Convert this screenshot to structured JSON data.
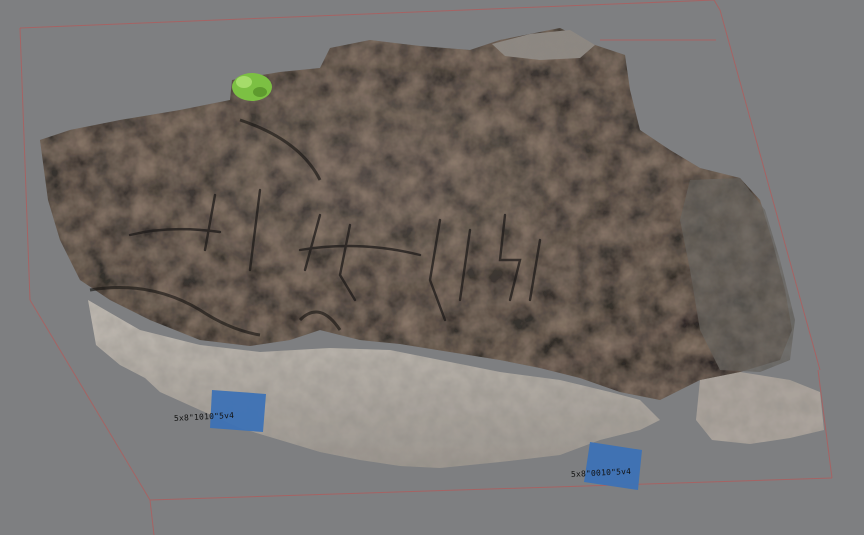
{
  "viewer": {
    "background_color": "#7e7f81",
    "bounding_box_color": "#b35a5a"
  },
  "model": {
    "dark_rock_color": "#3a3533",
    "light_rock_color": "#b2aca5",
    "highlight_color": "#8a6448"
  },
  "markers": [
    {
      "label": "5x8\"1010\"5v4",
      "color": "#3d72b5"
    },
    {
      "label": "5x8\"0010\"5v4",
      "color": "#3d72b5"
    }
  ],
  "vegetation": {
    "color": "#7cc043"
  }
}
